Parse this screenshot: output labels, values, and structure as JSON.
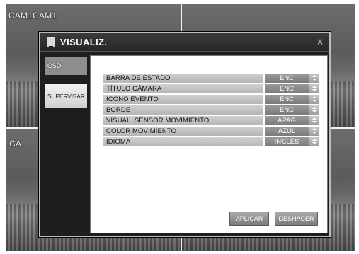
{
  "camera_labels": {
    "top_left": "CAM1CAM1",
    "bottom_left": "CA"
  },
  "dialog": {
    "title": "VISUALIZ.",
    "close_symbol": "×"
  },
  "side_tabs": [
    {
      "label": "OSD"
    },
    {
      "label": "SUPERVISAR"
    }
  ],
  "settings": [
    {
      "label": "BARRA DE ESTADO",
      "value": "ENC"
    },
    {
      "label": "TÍTULO CÁMARA",
      "value": "ENC"
    },
    {
      "label": "ICONO EVENTO",
      "value": "ENC"
    },
    {
      "label": "BORDE",
      "value": "ENC"
    },
    {
      "label": "VISUAL. SENSOR MOVIMIENTO",
      "value": "APAG"
    },
    {
      "label": "COLOR MOVIMIENTO",
      "value": "AZUL"
    },
    {
      "label": "IDIOMA",
      "value": "INGLÉS"
    }
  ],
  "buttons": {
    "apply": "APLICAR",
    "undo": "DESHACER"
  }
}
